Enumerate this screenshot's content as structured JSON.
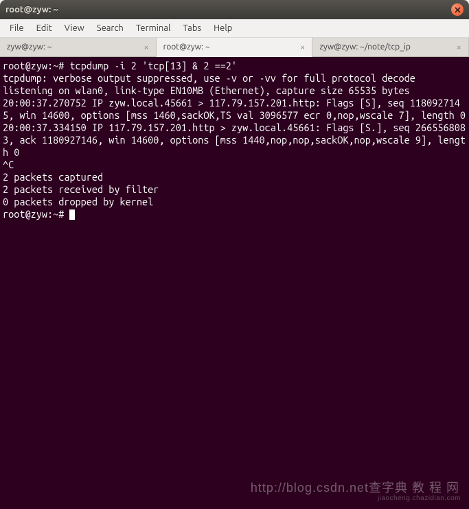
{
  "window": {
    "title": "root@zyw: ~"
  },
  "menu": {
    "file": "File",
    "edit": "Edit",
    "view": "View",
    "search": "Search",
    "terminal": "Terminal",
    "tabs": "Tabs",
    "help": "Help"
  },
  "tabs": [
    {
      "label": "zyw@zyw: ~",
      "active": false
    },
    {
      "label": "root@zyw: ~",
      "active": true
    },
    {
      "label": "zyw@zyw: ~/note/tcp_ip",
      "active": false
    }
  ],
  "terminal": {
    "prompt1": "root@zyw:~# ",
    "cmd1": "tcpdump -i 2 'tcp[13] & 2 ==2'",
    "line2": "tcpdump: verbose output suppressed, use -v or -vv for full protocol decode",
    "line3": "listening on wlan0, link-type EN10MB (Ethernet), capture size 65535 bytes",
    "line4": "20:00:37.270752 IP zyw.local.45661 > 117.79.157.201.http: Flags [S], seq 1180927145, win 14600, options [mss 1460,sackOK,TS val 3096577 ecr 0,nop,wscale 7], length 0",
    "line5": "20:00:37.334150 IP 117.79.157.201.http > zyw.local.45661: Flags [S.], seq 2665568083, ack 1180927146, win 14600, options [mss 1440,nop,nop,sackOK,nop,wscale 9], length 0",
    "line6": "^C",
    "line7": "2 packets captured",
    "line8": "2 packets received by filter",
    "line9": "0 packets dropped by kernel",
    "prompt2": "root@zyw:~# "
  },
  "watermark": {
    "main": "http://blog.csdn.net查字典 教 程 网",
    "sub": "jiaocheng.chazidian.com"
  }
}
